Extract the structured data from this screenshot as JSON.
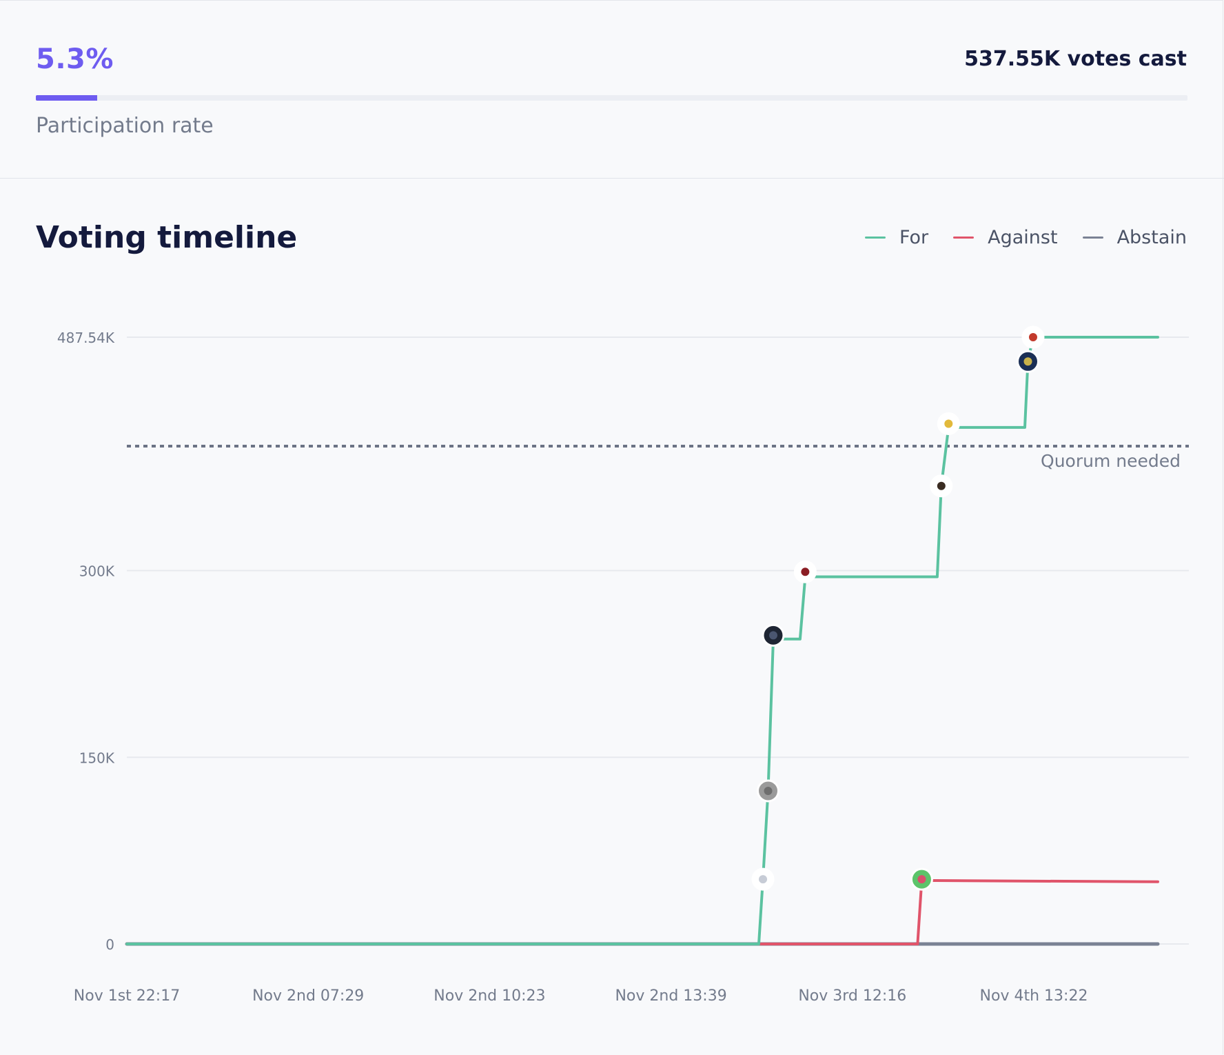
{
  "participation": {
    "rate_text": "5.3%",
    "rate_fraction": 0.053,
    "label": "Participation rate",
    "votes_cast": "537.55K votes cast"
  },
  "timeline": {
    "title": "Voting timeline",
    "legend": [
      {
        "label": "For",
        "color": "#5bc2a0"
      },
      {
        "label": "Against",
        "color": "#e0546a"
      },
      {
        "label": "Abstain",
        "color": "#7a8294"
      }
    ],
    "quorum_label": "Quorum needed"
  },
  "colors": {
    "accent": "#6e5cf0",
    "for": "#5bc2a0",
    "against": "#e0546a",
    "abstain": "#7a8294",
    "quorum_line": "#6b7385",
    "grid": "#e7e9ee",
    "axis_text": "#737b8c"
  },
  "chart_data": {
    "type": "line",
    "line_shape": "step",
    "ylim": [
      0,
      487540
    ],
    "y_ticks": [
      {
        "value": 0,
        "label": "0"
      },
      {
        "value": 150000,
        "label": "150K"
      },
      {
        "value": 300000,
        "label": "300K"
      },
      {
        "value": 487540,
        "label": "487.54K"
      }
    ],
    "x_ticks": [
      "Nov 1st 22:17",
      "Nov 2nd 07:29",
      "Nov 2nd 10:23",
      "Nov 2nd 13:39",
      "Nov 3rd 12:16",
      "Nov 4th 13:22"
    ],
    "x_range": [
      0,
      1
    ],
    "quorum": 400000,
    "grid": true,
    "legend_position": "top-right",
    "series": [
      {
        "name": "For",
        "color": "#5bc2a0",
        "points": [
          {
            "x": 0.0,
            "y": 0
          },
          {
            "x": 0.613,
            "y": 0
          },
          {
            "x": 0.617,
            "y": 52000
          },
          {
            "x": 0.622,
            "y": 123000
          },
          {
            "x": 0.627,
            "y": 245000
          },
          {
            "x": 0.653,
            "y": 245000
          },
          {
            "x": 0.658,
            "y": 295000
          },
          {
            "x": 0.786,
            "y": 295000
          },
          {
            "x": 0.79,
            "y": 368000
          },
          {
            "x": 0.797,
            "y": 415000
          },
          {
            "x": 0.871,
            "y": 415000
          },
          {
            "x": 0.874,
            "y": 468000
          },
          {
            "x": 0.879,
            "y": 487540
          },
          {
            "x": 1.0,
            "y": 487540
          }
        ],
        "voters": [
          {
            "x": 0.617,
            "y": 52000,
            "icon": "network-avatar-icon"
          },
          {
            "x": 0.622,
            "y": 123000,
            "icon": "gray-sphere-avatar-icon"
          },
          {
            "x": 0.627,
            "y": 248000,
            "icon": "pixel-logo-avatar-icon"
          },
          {
            "x": 0.658,
            "y": 299000,
            "icon": "red-hexagon-avatar-icon"
          },
          {
            "x": 0.79,
            "y": 368000,
            "icon": "portrait-avatar-icon"
          },
          {
            "x": 0.797,
            "y": 418000,
            "icon": "gold-coins-avatar-icon"
          },
          {
            "x": 0.874,
            "y": 468000,
            "icon": "m-logo-avatar-icon"
          },
          {
            "x": 0.879,
            "y": 487540,
            "icon": "red-bull-avatar-icon"
          }
        ]
      },
      {
        "name": "Against",
        "color": "#e0546a",
        "points": [
          {
            "x": 0.0,
            "y": 0
          },
          {
            "x": 0.767,
            "y": 0
          },
          {
            "x": 0.771,
            "y": 51000
          },
          {
            "x": 1.0,
            "y": 50000
          }
        ],
        "voters": [
          {
            "x": 0.771,
            "y": 52000,
            "icon": "green-face-avatar-icon"
          }
        ]
      },
      {
        "name": "Abstain",
        "color": "#7a8294",
        "points": [
          {
            "x": 0.0,
            "y": 0
          },
          {
            "x": 1.0,
            "y": 0
          }
        ],
        "voters": []
      }
    ]
  }
}
